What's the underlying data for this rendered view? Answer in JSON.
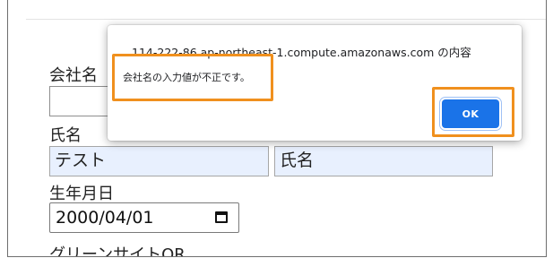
{
  "form": {
    "company_label": "会社名",
    "company_value": "",
    "name_label": "氏名",
    "last_name_value": "テスト",
    "first_name_value": "氏名",
    "dob_label": "生年月日",
    "dob_value": "2000/04/01",
    "green_site_label": "グリーンサイトQR"
  },
  "dialog": {
    "title": "114-222-86.ap-northeast-1.compute.amazonaws.com の内容",
    "message": "会社名の入力値が不正です。",
    "ok_label": "OK"
  },
  "colors": {
    "highlight": "#f0901e",
    "ok_button": "#1a73e8",
    "autofill": "#e8f0fe"
  }
}
